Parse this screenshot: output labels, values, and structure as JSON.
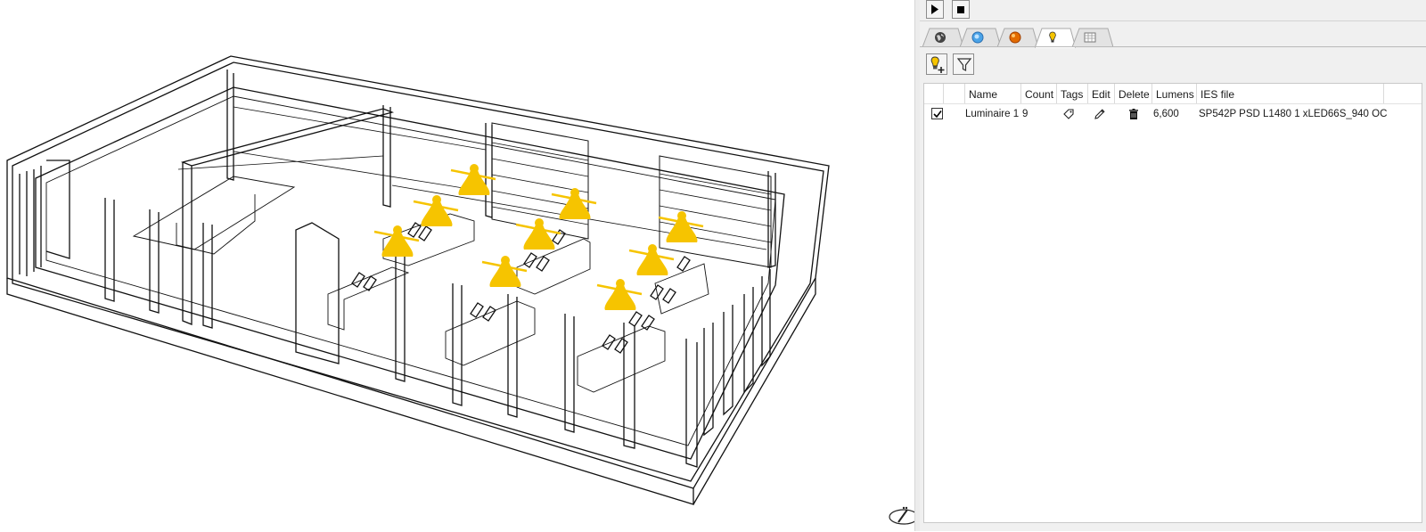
{
  "toolbar": {
    "play_icon": "play-icon",
    "stop_icon": "stop-icon"
  },
  "tabs": [
    {
      "name": "environment",
      "icon": "globe-icon",
      "active": false
    },
    {
      "name": "sky",
      "icon": "sky-sphere-icon",
      "active": false
    },
    {
      "name": "materials",
      "icon": "material-sphere-icon",
      "active": false
    },
    {
      "name": "lights",
      "icon": "lightbulb-icon",
      "active": true
    },
    {
      "name": "table",
      "icon": "table-icon",
      "active": false
    }
  ],
  "actions": {
    "add_luminaire_icon": "add-luminaire-icon",
    "filter_icon": "filter-icon"
  },
  "table": {
    "columns": [
      "Name",
      "Count",
      "Tags",
      "Edit",
      "Delete",
      "Lumens",
      "IES file"
    ],
    "rows": [
      {
        "checked": true,
        "name": "Luminaire 1",
        "count": "9",
        "tags_icon": "tag-icon",
        "edit_icon": "pencil-icon",
        "delete_icon": "trash-icon",
        "lumens": "6,600",
        "ies_file": "SP542P PSD L1480 1 xLED66S_940 OC"
      }
    ]
  },
  "colors": {
    "luminaire_yellow": "#f6c400",
    "panel_bg": "#f0f0f0",
    "wireframe": "#111111"
  }
}
